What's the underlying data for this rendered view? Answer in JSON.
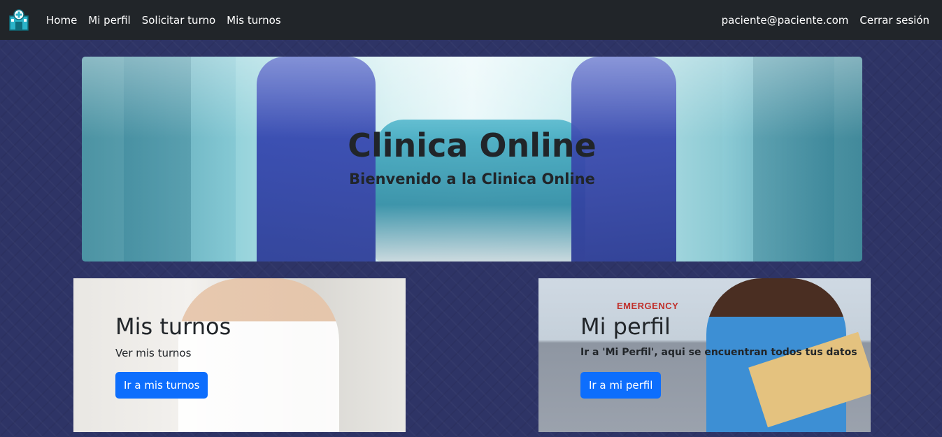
{
  "navbar": {
    "logo_icon": "hospital-icon",
    "links": [
      "Home",
      "Mi perfil",
      "Solicitar turno",
      "Mis turnos"
    ],
    "user_email": "paciente@paciente.com",
    "logout": "Cerrar sesión"
  },
  "hero": {
    "title": "Clinica Online",
    "subtitle": "Bienvenido a la Clinica Online"
  },
  "cards": [
    {
      "title": "Mis turnos",
      "text": "Ver mis turnos",
      "button": "Ir a mis turnos"
    },
    {
      "title": "Mi perfil",
      "text": "Ir a 'Mi Perfil', aqui se encuentran todos tus datos",
      "button": "Ir a mi perfil",
      "sign": "EMERGENCY"
    }
  ],
  "colors": {
    "navbar": "#212529",
    "background": "#2e3466",
    "primary_button": "#0d6efd"
  }
}
